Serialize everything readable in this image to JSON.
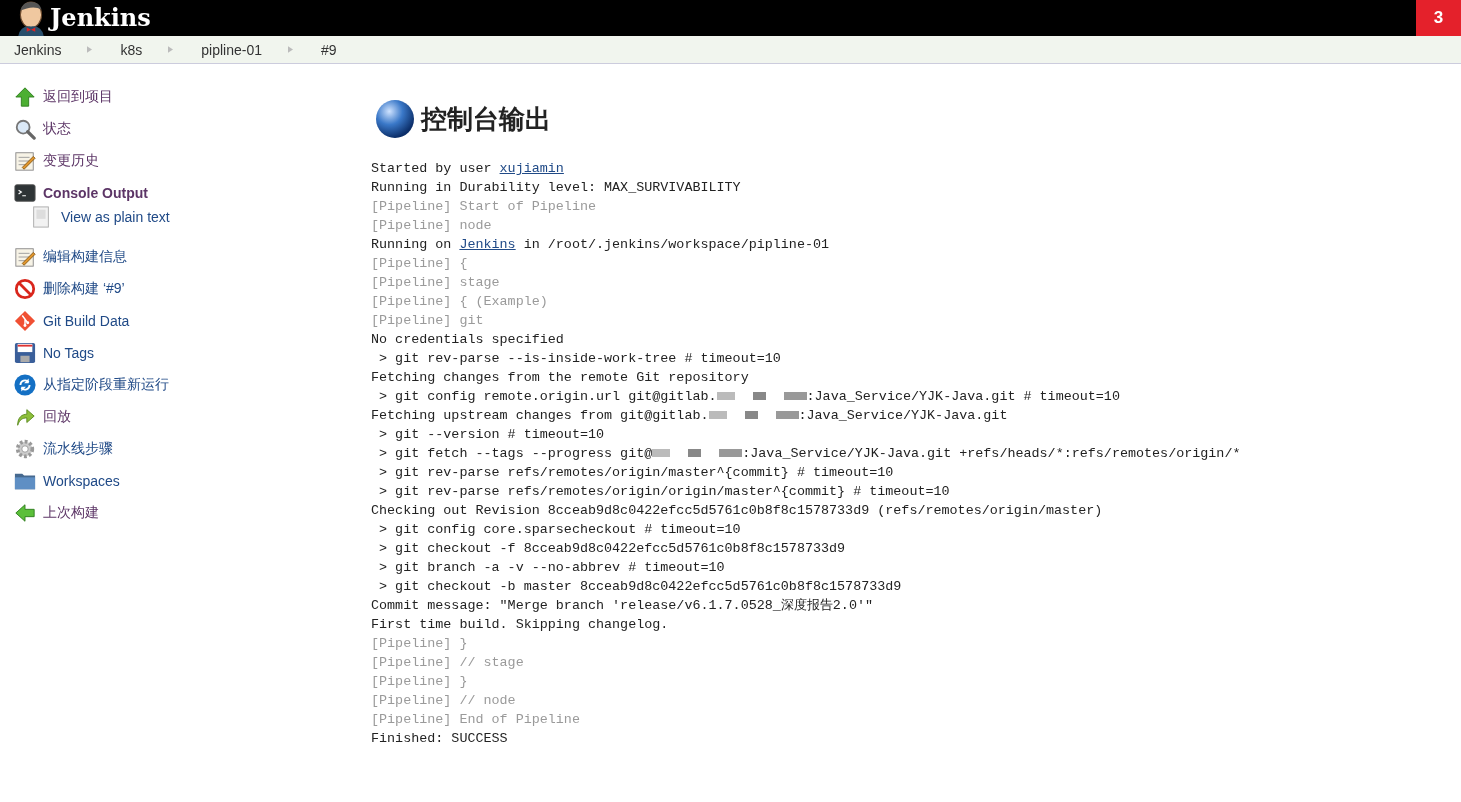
{
  "header": {
    "logo_text": "Jenkins",
    "badge": "3"
  },
  "breadcrumbs": [
    "Jenkins",
    "k8s",
    "pipline-01",
    "#9"
  ],
  "sidebar": {
    "items": [
      {
        "kind": "up",
        "label": "返回到项目",
        "visited": true,
        "selected": false
      },
      {
        "kind": "search",
        "label": "状态",
        "visited": true,
        "selected": false
      },
      {
        "kind": "notepad",
        "label": "变更历史",
        "visited": true,
        "selected": false
      },
      {
        "kind": "terminal",
        "label": "Console Output",
        "visited": true,
        "selected": true,
        "children": [
          {
            "kind": "document",
            "label": "View as plain text",
            "visited": false,
            "selected": false
          }
        ]
      },
      {
        "kind": "notepad",
        "label": "编辑构建信息",
        "visited": false,
        "selected": false
      },
      {
        "kind": "forbidden",
        "label": "删除构建 ‘#9’",
        "visited": false,
        "selected": false
      },
      {
        "kind": "git",
        "label": "Git Build Data",
        "visited": false,
        "selected": false
      },
      {
        "kind": "floppy",
        "label": "No Tags",
        "visited": false,
        "selected": false
      },
      {
        "kind": "refresh",
        "label": "从指定阶段重新运行",
        "visited": false,
        "selected": false
      },
      {
        "kind": "redo",
        "label": "回放",
        "visited": true,
        "selected": false
      },
      {
        "kind": "gear",
        "label": "流水线步骤",
        "visited": false,
        "selected": false
      },
      {
        "kind": "folder",
        "label": "Workspaces",
        "visited": false,
        "selected": false
      },
      {
        "kind": "back",
        "label": "上次构建",
        "visited": true,
        "selected": false
      }
    ]
  },
  "page_title": "控制台输出",
  "console": [
    {
      "kind": "plain",
      "parts": [
        {
          "kind": "text",
          "text": "Started by user "
        },
        {
          "kind": "link",
          "text": "xujiamin"
        }
      ]
    },
    {
      "kind": "plain",
      "parts": [
        {
          "kind": "text",
          "text": "Running in Durability level: MAX_SURVIVABILITY"
        }
      ]
    },
    {
      "kind": "pipeline",
      "parts": [
        {
          "kind": "text",
          "text": "[Pipeline] Start of Pipeline"
        }
      ]
    },
    {
      "kind": "pipeline",
      "parts": [
        {
          "kind": "text",
          "text": "[Pipeline] node"
        }
      ]
    },
    {
      "kind": "plain",
      "parts": [
        {
          "kind": "text",
          "text": "Running on "
        },
        {
          "kind": "link",
          "text": "Jenkins"
        },
        {
          "kind": "text",
          "text": " in /root/.jenkins/workspace/pipline-01"
        }
      ]
    },
    {
      "kind": "pipeline",
      "parts": [
        {
          "kind": "text",
          "text": "[Pipeline] {"
        }
      ]
    },
    {
      "kind": "pipeline",
      "parts": [
        {
          "kind": "text",
          "text": "[Pipeline] stage"
        }
      ]
    },
    {
      "kind": "pipeline",
      "parts": [
        {
          "kind": "text",
          "text": "[Pipeline] { (Example)"
        }
      ]
    },
    {
      "kind": "pipeline",
      "parts": [
        {
          "kind": "text",
          "text": "[Pipeline] git"
        }
      ]
    },
    {
      "kind": "plain",
      "parts": [
        {
          "kind": "text",
          "text": "No credentials specified"
        }
      ]
    },
    {
      "kind": "plain",
      "parts": [
        {
          "kind": "text",
          "text": " > git rev-parse --is-inside-work-tree # timeout=10"
        }
      ]
    },
    {
      "kind": "plain",
      "parts": [
        {
          "kind": "text",
          "text": "Fetching changes from the remote Git repository"
        }
      ]
    },
    {
      "kind": "plain",
      "parts": [
        {
          "kind": "text",
          "text": " > git config remote.origin.url git@gitlab."
        },
        {
          "kind": "redacted"
        },
        {
          "kind": "text",
          "text": ":Java_Service/YJK-Java.git # timeout=10"
        }
      ]
    },
    {
      "kind": "plain",
      "parts": [
        {
          "kind": "text",
          "text": "Fetching upstream changes from git@gitlab."
        },
        {
          "kind": "redacted"
        },
        {
          "kind": "text",
          "text": ":Java_Service/YJK-Java.git"
        }
      ]
    },
    {
      "kind": "plain",
      "parts": [
        {
          "kind": "text",
          "text": " > git --version # timeout=10"
        }
      ]
    },
    {
      "kind": "plain",
      "parts": [
        {
          "kind": "text",
          "text": " > git fetch --tags --progress git@"
        },
        {
          "kind": "redacted"
        },
        {
          "kind": "text",
          "text": ":Java_Service/YJK-Java.git +refs/heads/*:refs/remotes/origin/*"
        }
      ]
    },
    {
      "kind": "plain",
      "parts": [
        {
          "kind": "text",
          "text": " > git rev-parse refs/remotes/origin/master^{commit} # timeout=10"
        }
      ]
    },
    {
      "kind": "plain",
      "parts": [
        {
          "kind": "text",
          "text": " > git rev-parse refs/remotes/origin/origin/master^{commit} # timeout=10"
        }
      ]
    },
    {
      "kind": "plain",
      "parts": [
        {
          "kind": "text",
          "text": "Checking out Revision 8cceab9d8c0422efcc5d5761c0b8f8c1578733d9 (refs/remotes/origin/master)"
        }
      ]
    },
    {
      "kind": "plain",
      "parts": [
        {
          "kind": "text",
          "text": " > git config core.sparsecheckout # timeout=10"
        }
      ]
    },
    {
      "kind": "plain",
      "parts": [
        {
          "kind": "text",
          "text": " > git checkout -f 8cceab9d8c0422efcc5d5761c0b8f8c1578733d9"
        }
      ]
    },
    {
      "kind": "plain",
      "parts": [
        {
          "kind": "text",
          "text": " > git branch -a -v --no-abbrev # timeout=10"
        }
      ]
    },
    {
      "kind": "plain",
      "parts": [
        {
          "kind": "text",
          "text": " > git checkout -b master 8cceab9d8c0422efcc5d5761c0b8f8c1578733d9"
        }
      ]
    },
    {
      "kind": "plain",
      "parts": [
        {
          "kind": "text",
          "text": "Commit message: \"Merge branch 'release/v6.1.7.0528_深度报告2.0'\""
        }
      ]
    },
    {
      "kind": "plain",
      "parts": [
        {
          "kind": "text",
          "text": "First time build. Skipping changelog."
        }
      ]
    },
    {
      "kind": "pipeline",
      "parts": [
        {
          "kind": "text",
          "text": "[Pipeline] }"
        }
      ]
    },
    {
      "kind": "pipeline",
      "parts": [
        {
          "kind": "text",
          "text": "[Pipeline] // stage"
        }
      ]
    },
    {
      "kind": "pipeline",
      "parts": [
        {
          "kind": "text",
          "text": "[Pipeline] }"
        }
      ]
    },
    {
      "kind": "pipeline",
      "parts": [
        {
          "kind": "text",
          "text": "[Pipeline] // node"
        }
      ]
    },
    {
      "kind": "pipeline",
      "parts": [
        {
          "kind": "text",
          "text": "[Pipeline] End of Pipeline"
        }
      ]
    },
    {
      "kind": "plain",
      "parts": [
        {
          "kind": "text",
          "text": "Finished: SUCCESS"
        }
      ]
    }
  ]
}
